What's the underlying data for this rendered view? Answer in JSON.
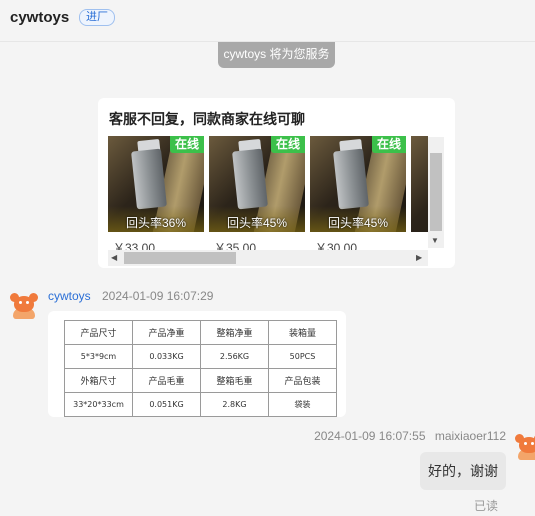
{
  "header": {
    "title": "cywtoys",
    "badge": "进厂"
  },
  "system_notice": "cywtoys 将为您服务",
  "recommendation": {
    "title": "客服不回复，同款商家在线可聊",
    "products": [
      {
        "online": "在线",
        "repurchase": "回头率36%",
        "price": "￥33.00"
      },
      {
        "online": "在线",
        "repurchase": "回头率45%",
        "price": "￥35.00"
      },
      {
        "online": "在线",
        "repurchase": "回头率45%",
        "price": "￥30.00"
      }
    ],
    "scroll_down_icon": "▼",
    "scroll_left_icon": "◀",
    "scroll_right_icon": "▶"
  },
  "incoming": {
    "sender": "cywtoys",
    "time": "2024-01-09 16:07:29",
    "spec_table": [
      [
        "产品尺寸",
        "产品净重",
        "整箱净重",
        "装箱量"
      ],
      [
        "5*3*9cm",
        "0.033KG",
        "2.56KG",
        "50PCS"
      ],
      [
        "外箱尺寸",
        "产品毛重",
        "整箱毛重",
        "产品包装"
      ],
      [
        "33*20*33cm",
        "0.051KG",
        "2.8KG",
        "袋装"
      ]
    ]
  },
  "outgoing": {
    "time": "2024-01-09 16:07:55",
    "sender": "maixiaoer112",
    "text": "好的，谢谢",
    "status": "已读"
  }
}
